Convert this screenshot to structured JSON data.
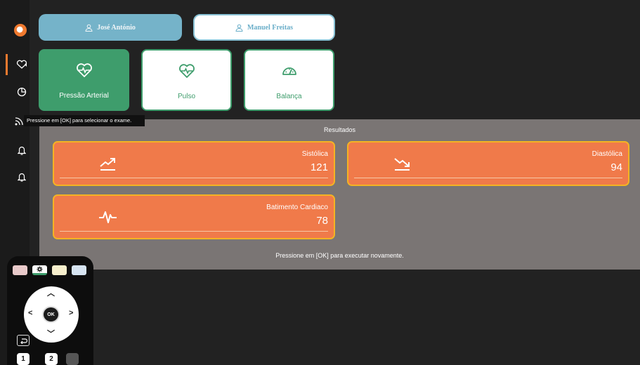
{
  "users": {
    "active": "José António",
    "inactive": "Manuel Freitas"
  },
  "exams": [
    {
      "label": "Pressão Arterial",
      "icon": "heart-pulse-icon",
      "selected": true
    },
    {
      "label": "Pulso",
      "icon": "heart-pulse-icon",
      "selected": false
    },
    {
      "label": "Balança",
      "icon": "scale-gauge-icon",
      "selected": false
    }
  ],
  "tooltip": "Pressione em [OK] para selecionar o exame.",
  "results": {
    "title": "Resultados",
    "systolic": {
      "label": "Sistólica",
      "value": "121",
      "icon": "trend-up-icon"
    },
    "diastolic": {
      "label": "Diastólica",
      "value": "94",
      "icon": "trend-down-icon"
    },
    "heart_rate": {
      "label": "Batimento Cardiaco",
      "value": "78",
      "icon": "pulse-wave-icon"
    },
    "footer": "Pressione em [OK] para executar novamente."
  },
  "remote": {
    "ok_label": "OK",
    "num_keys": [
      "1",
      "2"
    ]
  },
  "colors": {
    "background": "#222222",
    "green": "#3e9d6c",
    "orange": "#f07a4a",
    "orange_border": "#f4b323",
    "user_blue": "#75b3c9",
    "results_panel": "#7a7574"
  }
}
